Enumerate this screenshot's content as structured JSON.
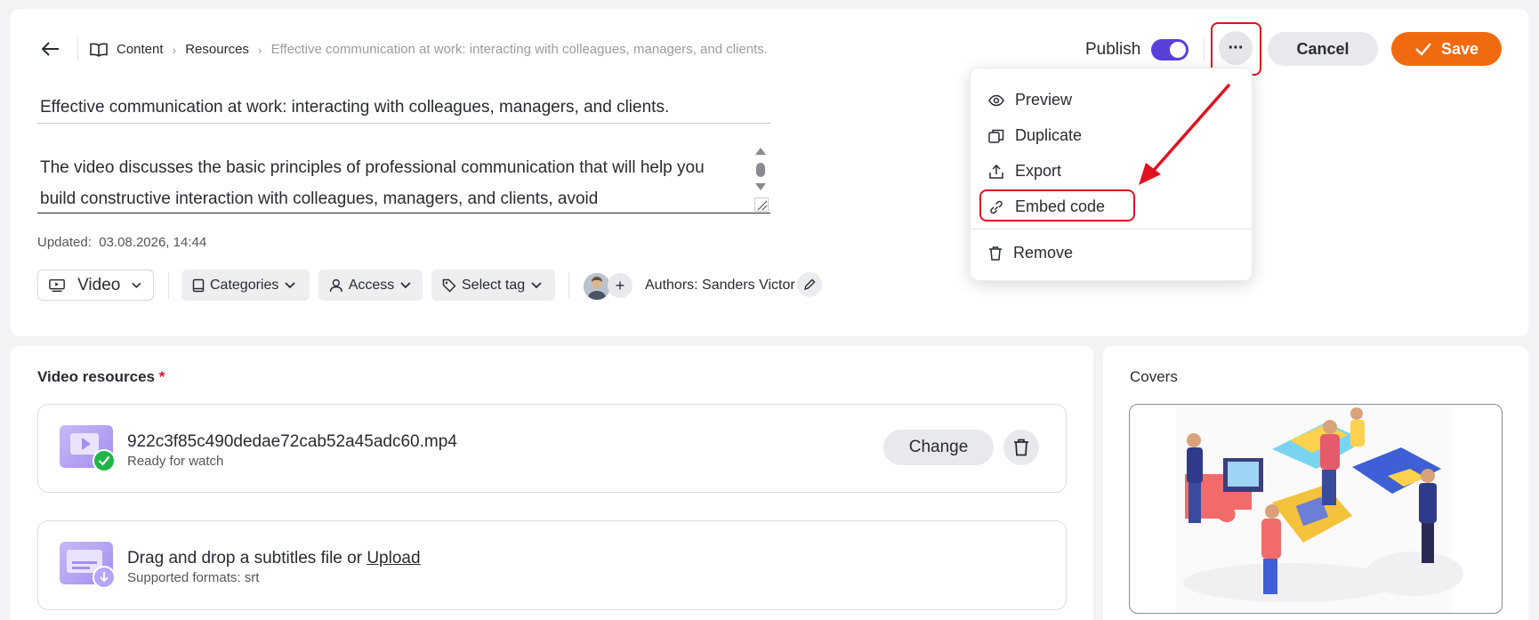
{
  "breadcrumb": {
    "items": [
      "Content",
      "Resources",
      "Effective communication at work: interacting with colleagues, managers, and clients."
    ]
  },
  "header": {
    "publish_label": "Publish",
    "publish_on": true,
    "more_label": "···",
    "cancel_label": "Cancel",
    "save_label": "Save"
  },
  "menu": {
    "preview": "Preview",
    "duplicate": "Duplicate",
    "export": "Export",
    "embed_code": "Embed code",
    "remove": "Remove"
  },
  "form": {
    "title": "Effective communication at work: interacting with colleagues, managers, and clients.",
    "description": "The video discusses the basic principles of professional communication that will help you build constructive interaction with colleagues, managers, and clients, avoid",
    "updated_label": "Updated:",
    "updated_value": "03.08.2026, 14:44"
  },
  "toolbar": {
    "type_label": "Video",
    "categories_label": "Categories",
    "access_label": "Access",
    "tag_label": "Select tag",
    "authors_text": "Authors: Sanders Victor"
  },
  "video_resources": {
    "title": "Video resources",
    "required_mark": "*",
    "file_name": "922c3f85c490dedae72cab52a45adc60.mp4",
    "file_status": "Ready for watch",
    "change_label": "Change",
    "subtitles_prefix": "Drag and drop a subtitles file or ",
    "subtitles_link": "Upload",
    "subtitles_formats": "Supported formats: srt"
  },
  "covers": {
    "title": "Covers"
  },
  "colors": {
    "accent": "#5b3fd9",
    "save": "#f26a0f",
    "highlight": "#e0121f",
    "success": "#1fb54a"
  }
}
